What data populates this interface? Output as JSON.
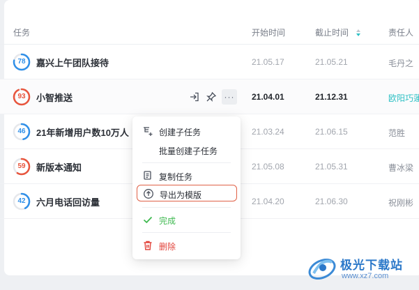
{
  "table": {
    "columns": {
      "task": "任务",
      "start": "开始时间",
      "due": "截止时间",
      "owner": "责任人"
    },
    "sort_column": "due",
    "rows": [
      {
        "score": "78",
        "progress": 0.78,
        "ring_color": "#2f8fe8",
        "name": "嘉兴上午团队接待",
        "start": "21.05.17",
        "due": "21.05.21",
        "owner": "毛丹之"
      },
      {
        "score": "93",
        "progress": 0.93,
        "ring_color": "#e8553d",
        "name": "小智推送",
        "start": "21.04.01",
        "due": "21.12.31",
        "owner": "欧阳巧蓮"
      },
      {
        "score": "46",
        "progress": 0.46,
        "ring_color": "#2f8fe8",
        "name": "21年新增用户数10万人",
        "start": "21.03.24",
        "due": "21.06.15",
        "owner": "范胜"
      },
      {
        "score": "59",
        "progress": 0.59,
        "ring_color": "#e8553d",
        "name": "新版本通知",
        "start": "21.05.08",
        "due": "21.05.31",
        "owner": "曹冰梁"
      },
      {
        "score": "42",
        "progress": 0.42,
        "ring_color": "#2f8fe8",
        "name": "六月电话回访量",
        "start": "21.04.20",
        "due": "21.06.30",
        "owner": "祝刚彬"
      }
    ]
  },
  "row_actions": {
    "icons": [
      "enter-icon",
      "pin-icon",
      "more-icon"
    ],
    "more_label": "···"
  },
  "context_menu": {
    "items": {
      "create_subtask": {
        "label": "创建子任务",
        "icon": "create-subtask-icon"
      },
      "batch_create_subtask": {
        "label": "批量创建子任务"
      },
      "copy_task": {
        "label": "复制任务",
        "icon": "copy-icon"
      },
      "export_template": {
        "label": "导出为模版",
        "icon": "export-icon"
      },
      "complete": {
        "label": "完成",
        "icon": "check-icon"
      },
      "delete": {
        "label": "删除",
        "icon": "trash-icon"
      }
    }
  },
  "watermark": {
    "title": "极光下载站",
    "url": "www.xz7.com"
  },
  "colors": {
    "accent_blue": "#2f8fe8",
    "accent_red": "#e8553d",
    "link_teal": "#2ec0c4",
    "success_green": "#3fb950",
    "danger_red": "#e2453c"
  }
}
